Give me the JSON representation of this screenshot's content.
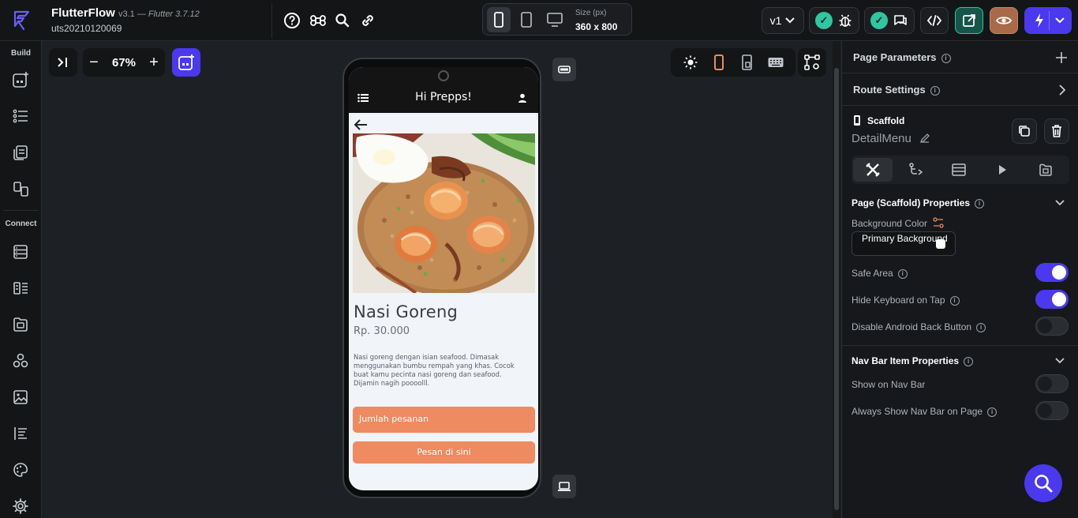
{
  "app": {
    "name": "FlutterFlow",
    "version": "v3.1 —",
    "flutter_version": "Flutter 3.7.12",
    "project_id": "uts20210120069"
  },
  "toolbar": {
    "size_label": "Size (px)",
    "size_value": "360 x 800",
    "version_selector": "v1"
  },
  "sidebar": {
    "build_label": "Build",
    "connect_label": "Connect"
  },
  "canvas": {
    "zoom_value": "67%"
  },
  "preview": {
    "appbar_title": "Hi Prepps!",
    "menu_name": "Nasi Goreng",
    "price": "Rp. 30.000",
    "description": "Nasi goreng dengan isian seafood. Dimasak menggunakan bumbu rempah yang khas. Cocok buat kamu pecinta nasi goreng dan seafood. Dijamin nagih poooolll.",
    "quantity_placeholder": "Jumlah pesanan",
    "order_button": "Pesan di sini"
  },
  "panel": {
    "page_parameters": "Page Parameters",
    "route_settings": "Route Settings",
    "widget_type": "Scaffold",
    "page_name": "DetailMenu",
    "scaffold_section": "Page (Scaffold) Properties",
    "background_color_label": "Background Color",
    "background_color_value": "Primary Background",
    "safe_area_label": "Safe Area",
    "safe_area_on": true,
    "hide_keyboard_label": "Hide Keyboard on Tap",
    "hide_keyboard_on": true,
    "disable_back_label": "Disable Android Back Button",
    "disable_back_on": false,
    "navbar_section": "Nav Bar Item Properties",
    "show_navbar_label": "Show on Nav Bar",
    "show_navbar_on": false,
    "always_show_navbar_label": "Always Show Nav Bar on Page",
    "always_show_navbar_on": false
  },
  "colors": {
    "accent": "#4b39ef",
    "primary_orange": "#ee8b60",
    "teal": "#2fc6a0",
    "brown_button": "#a86a4b",
    "teal_button_border": "#2fc6a0"
  }
}
